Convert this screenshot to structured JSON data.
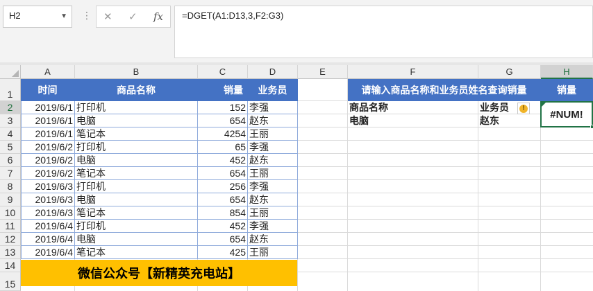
{
  "formula_bar": {
    "name_box": "H2",
    "formula": "=DGET(A1:D13,3,F2:G3)",
    "cancel_icon": "✕",
    "enter_icon": "✓",
    "fx_icon": "fx"
  },
  "columns": [
    "A",
    "B",
    "C",
    "D",
    "E",
    "F",
    "G",
    "H"
  ],
  "rows": [
    "1",
    "2",
    "3",
    "4",
    "5",
    "6",
    "7",
    "8",
    "9",
    "10",
    "11",
    "12",
    "13",
    "14",
    "15"
  ],
  "table": {
    "headers": [
      "时间",
      "商品名称",
      "销量",
      "业务员"
    ],
    "rows": [
      [
        "2019/6/1",
        "打印机",
        "152",
        "李强"
      ],
      [
        "2019/6/1",
        "电脑",
        "654",
        "赵东"
      ],
      [
        "2019/6/1",
        "笔记本",
        "4254",
        "王丽"
      ],
      [
        "2019/6/2",
        "打印机",
        "65",
        "李强"
      ],
      [
        "2019/6/2",
        "电脑",
        "452",
        "赵东"
      ],
      [
        "2019/6/2",
        "笔记本",
        "654",
        "王丽"
      ],
      [
        "2019/6/3",
        "打印机",
        "256",
        "李强"
      ],
      [
        "2019/6/3",
        "电脑",
        "654",
        "赵东"
      ],
      [
        "2019/6/3",
        "笔记本",
        "854",
        "王丽"
      ],
      [
        "2019/6/4",
        "打印机",
        "452",
        "李强"
      ],
      [
        "2019/6/4",
        "电脑",
        "654",
        "赵东"
      ],
      [
        "2019/6/4",
        "笔记本",
        "425",
        "王丽"
      ]
    ]
  },
  "banner": "微信公众号【新精英充电站】",
  "query": {
    "header": "请输入商品名称和业务员姓名查询销量",
    "result_header": "销量",
    "criteria_labels": [
      "商品名称",
      "业务员"
    ],
    "criteria_values": [
      "电脑",
      "赵东"
    ],
    "result": "#NUM!"
  },
  "colors": {
    "header_blue": "#4472c4",
    "banner_yellow": "#ffc000",
    "excel_green": "#217346"
  }
}
